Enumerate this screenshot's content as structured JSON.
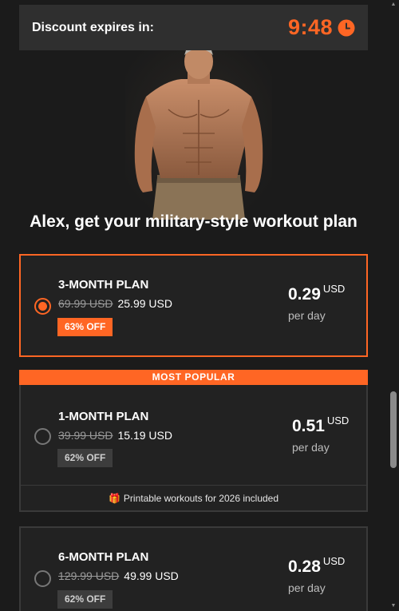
{
  "timer": {
    "label": "Discount expires in:",
    "value": "9:48",
    "icon": "clock-icon",
    "accent": "#ff6624"
  },
  "hero": {
    "icon": "athlete-photo"
  },
  "headline": "Alex, get your military-style workout plan",
  "plans": [
    {
      "name": "3-MONTH PLAN",
      "old_price": "69.99 USD",
      "price": "25.99 USD",
      "discount": "63% OFF",
      "per_day_amount": "0.29",
      "per_day_currency": "USD",
      "per_day_unit": "per day",
      "selected": true
    },
    {
      "name": "1-MONTH PLAN",
      "old_price": "39.99 USD",
      "price": "15.19 USD",
      "discount": "62% OFF",
      "per_day_amount": "0.51",
      "per_day_currency": "USD",
      "per_day_unit": "per day",
      "selected": false,
      "banner": "MOST POPULAR",
      "perk": "Printable workouts for 2026 included",
      "perk_icon": "gift-icon"
    },
    {
      "name": "6-MONTH PLAN",
      "old_price": "129.99 USD",
      "price": "49.99 USD",
      "discount": "62% OFF",
      "per_day_amount": "0.28",
      "per_day_currency": "USD",
      "per_day_unit": "per day",
      "selected": false
    }
  ],
  "colors": {
    "accent": "#ff6624",
    "background": "#1b1b1b",
    "card": "#222222"
  }
}
